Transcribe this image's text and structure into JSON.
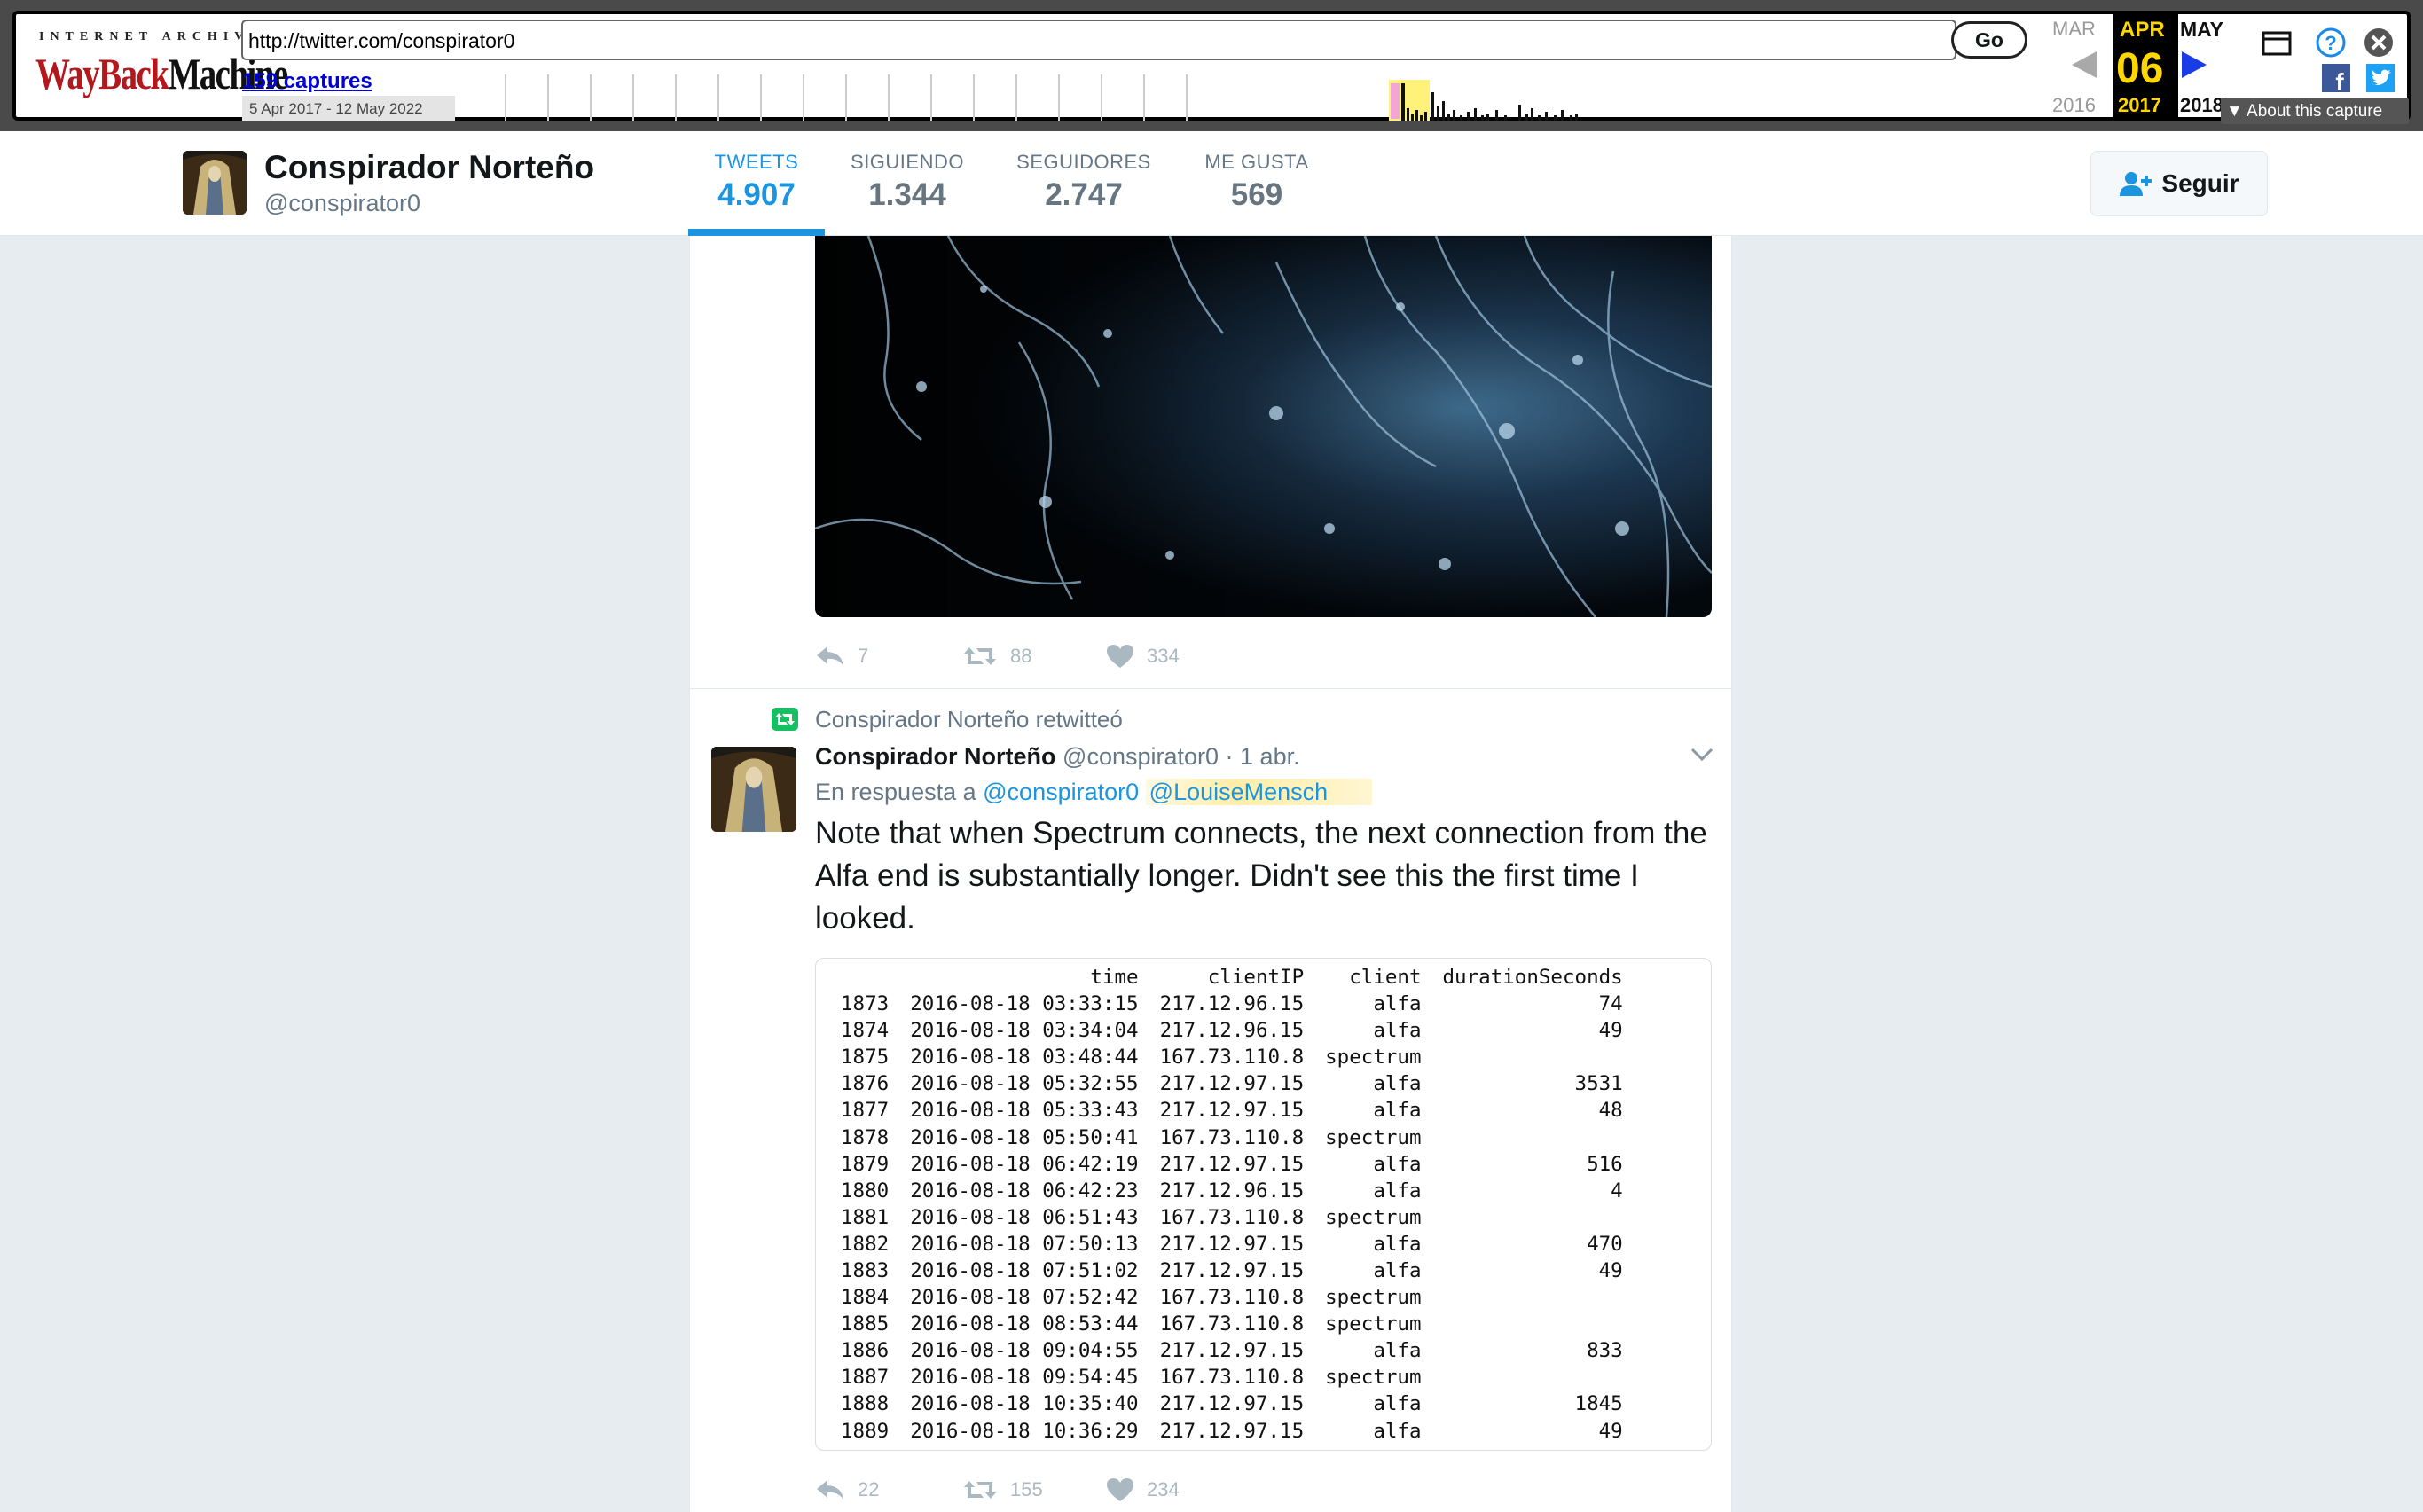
{
  "wayback": {
    "logo_top": "INTERNET ARCHIVE",
    "logo_way": "WayBack",
    "logo_machine": "Machine",
    "url": "http://twitter.com/conspirator0",
    "go_label": "Go",
    "captures_label": "159 captures",
    "range_label": "5 Apr 2017 - 12 May 2022",
    "prev_month": "MAR",
    "cur_month": "APR",
    "cur_day": "06",
    "cur_year": "2017",
    "next_month": "MAY",
    "prev_year": "2016",
    "next_year": "2018",
    "about_label": "About this capture"
  },
  "profile": {
    "name": "Conspirador Norteño",
    "handle": "@conspirator0",
    "stats": [
      {
        "label": "TWEETS",
        "value": "4.907"
      },
      {
        "label": "SIGUIENDO",
        "value": "1.344"
      },
      {
        "label": "SEGUIDORES",
        "value": "2.747"
      },
      {
        "label": "ME GUSTA",
        "value": "569"
      }
    ],
    "follow_label": "Seguir"
  },
  "tweet1": {
    "replies": "7",
    "retweets": "88",
    "likes": "334"
  },
  "tweet2": {
    "retweet_context": "Conspirador Norteño retwitteó",
    "author_name": "Conspirador Norteño",
    "author_handle": "@conspirator0",
    "time": "· 1 abr.",
    "reply_prefix": "En respuesta a",
    "reply_to_1": "@conspirator0",
    "reply_to_2": "@LouiseMensch",
    "text": "Note that when Spectrum connects, the next connection from the Alfa end is substantially longer.  Didn't see this the first time I looked.",
    "replies": "22",
    "retweets": "155",
    "likes": "234",
    "table": {
      "headers": [
        "",
        "time",
        "clientIP",
        "client",
        "durationSeconds"
      ],
      "rows": [
        [
          "1873",
          "2016-08-18 03:33:15",
          "217.12.96.15",
          "alfa",
          "74"
        ],
        [
          "1874",
          "2016-08-18 03:34:04",
          "217.12.96.15",
          "alfa",
          "49"
        ],
        [
          "1875",
          "2016-08-18 03:48:44",
          "167.73.110.8",
          "spectrum",
          ""
        ],
        [
          "1876",
          "2016-08-18 05:32:55",
          "217.12.97.15",
          "alfa",
          "3531"
        ],
        [
          "1877",
          "2016-08-18 05:33:43",
          "217.12.97.15",
          "alfa",
          "48"
        ],
        [
          "1878",
          "2016-08-18 05:50:41",
          "167.73.110.8",
          "spectrum",
          ""
        ],
        [
          "1879",
          "2016-08-18 06:42:19",
          "217.12.97.15",
          "alfa",
          "516"
        ],
        [
          "1880",
          "2016-08-18 06:42:23",
          "217.12.96.15",
          "alfa",
          "4"
        ],
        [
          "1881",
          "2016-08-18 06:51:43",
          "167.73.110.8",
          "spectrum",
          ""
        ],
        [
          "1882",
          "2016-08-18 07:50:13",
          "217.12.97.15",
          "alfa",
          "470"
        ],
        [
          "1883",
          "2016-08-18 07:51:02",
          "217.12.97.15",
          "alfa",
          "49"
        ],
        [
          "1884",
          "2016-08-18 07:52:42",
          "167.73.110.8",
          "spectrum",
          ""
        ],
        [
          "1885",
          "2016-08-18 08:53:44",
          "167.73.110.8",
          "spectrum",
          ""
        ],
        [
          "1886",
          "2016-08-18 09:04:55",
          "217.12.97.15",
          "alfa",
          "833"
        ],
        [
          "1887",
          "2016-08-18 09:54:45",
          "167.73.110.8",
          "spectrum",
          ""
        ],
        [
          "1888",
          "2016-08-18 10:35:40",
          "217.12.97.15",
          "alfa",
          "1845"
        ],
        [
          "1889",
          "2016-08-18 10:36:29",
          "217.12.97.15",
          "alfa",
          "49"
        ]
      ]
    }
  },
  "colors": {
    "twitter_blue": "#1b95e0",
    "retweet_green": "#17bf63",
    "wayback_red": "#b3191c",
    "wayback_gold": "#ffd700"
  },
  "icons": {
    "reply": "reply-icon",
    "retweet": "retweet-icon",
    "like": "heart-icon",
    "follow": "add-user-icon",
    "chevron": "chevron-down-icon"
  }
}
